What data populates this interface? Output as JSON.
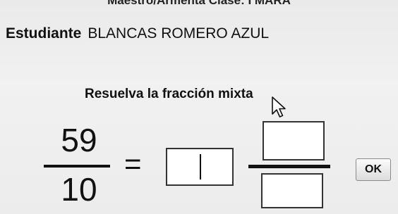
{
  "header": {
    "teacher_class_cut": "Maestro/Armenta    Clase: I MARA"
  },
  "student": {
    "label": "Estudiante",
    "name": "BLANCAS ROMERO AZUL"
  },
  "exercise": {
    "instruction": "Resuelva la fracción mixta",
    "numerator": "59",
    "denominator": "10",
    "equals": "=",
    "whole_value": "",
    "mixed_numerator_value": "",
    "mixed_denominator_value": ""
  },
  "ok_button": {
    "label": "OK"
  },
  "icons": {
    "cursor": "mouse-pointer-icon"
  }
}
